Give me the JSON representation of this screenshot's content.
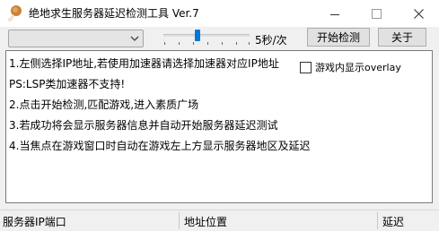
{
  "window": {
    "title": "绝地求生服务器延迟检测工具 Ver.7",
    "icon": "chicken-drumstick-icon"
  },
  "controls": {
    "server_combo_value": "",
    "interval_label": "5秒/次",
    "interval_slider_level_fraction": 0.36,
    "start_button": "开始检测",
    "about_button": "关于"
  },
  "info": {
    "lines": [
      "1.左侧选择IP地址,若使用加速器请选择加速器对应IP地址",
      "PS:LSP类加速器不支持!",
      "2.点击开始检测,匹配游戏,进入素质广场",
      "3.若成功将会显示服务器信息并自动开始服务器延迟测试",
      "4.当焦点在游戏窗口时自动在游戏左上方显示服务器地区及延迟"
    ],
    "overlay_checkbox_label": "游戏内显示overlay",
    "overlay_checked": false
  },
  "status_bar": {
    "server_ip_port": "服务器IP端口",
    "address_location": "地址位置",
    "latency": "延迟"
  }
}
